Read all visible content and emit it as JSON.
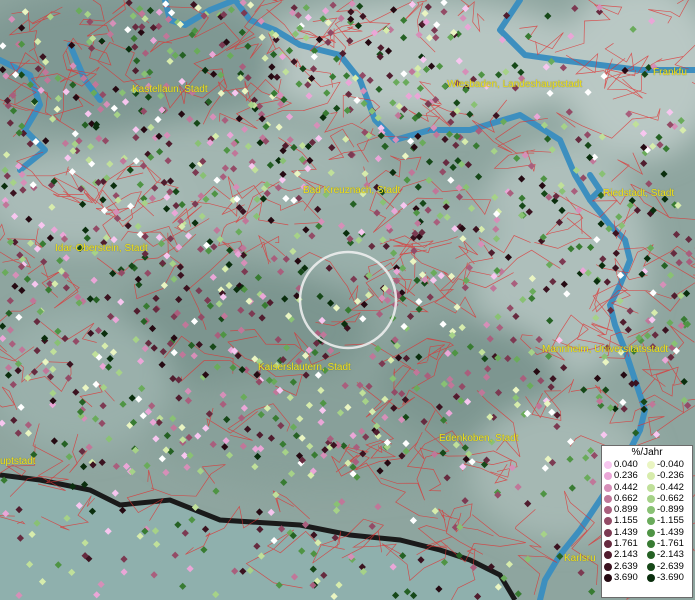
{
  "cities": [
    {
      "name": "Kastellaun, Stadt"
    },
    {
      "name": "Wiesbaden, Landeshauptstadt"
    },
    {
      "name": "Frankfu"
    },
    {
      "name": "Bad Kreuznach, Stadt"
    },
    {
      "name": "Riedstadt, Stadt"
    },
    {
      "name": "Idar-Oberstein, Stadt"
    },
    {
      "name": "Mannheim, Universitätsstadt"
    },
    {
      "name": "Kaiserslautern, Stadt"
    },
    {
      "name": "Edenkoben, Stadt"
    },
    {
      "name": "uptstadt"
    },
    {
      "name": "Karlsru"
    }
  ],
  "legend": {
    "title": "%/Jahr",
    "rows": [
      {
        "pos": "0.040",
        "neg": "-0.040",
        "pos_color": "#f7c6ef",
        "neg_color": "#eaf5c2"
      },
      {
        "pos": "0.236",
        "neg": "-0.236",
        "pos_color": "#eaa6d7",
        "neg_color": "#d7ecac"
      },
      {
        "pos": "0.442",
        "neg": "-0.442",
        "pos_color": "#d68fb8",
        "neg_color": "#c0e09a"
      },
      {
        "pos": "0.662",
        "neg": "-0.662",
        "pos_color": "#c07799",
        "neg_color": "#a6d288"
      },
      {
        "pos": "0.899",
        "neg": "-0.899",
        "pos_color": "#a95f7d",
        "neg_color": "#89c174"
      },
      {
        "pos": "1.155",
        "neg": "-1.155",
        "pos_color": "#934b66",
        "neg_color": "#6aab5b"
      },
      {
        "pos": "1.439",
        "neg": "-1.439",
        "pos_color": "#7c3a52",
        "neg_color": "#4f9444"
      },
      {
        "pos": "1.761",
        "neg": "-1.761",
        "pos_color": "#662b3f",
        "neg_color": "#387b32"
      },
      {
        "pos": "2.143",
        "neg": "-2.143",
        "pos_color": "#501d2e",
        "neg_color": "#256124"
      },
      {
        "pos": "2.639",
        "neg": "-2.639",
        "pos_color": "#3b1320",
        "neg_color": "#164818"
      },
      {
        "pos": "3.690",
        "neg": "-3.690",
        "pos_color": "#250a12",
        "neg_color": "#0a2e0d"
      }
    ]
  },
  "marker": "circle-marker",
  "colors": {
    "river": "#3d8fbf",
    "border": "#e03030",
    "city_label": "#f2e21c",
    "terrain": "#8fa8a3"
  }
}
